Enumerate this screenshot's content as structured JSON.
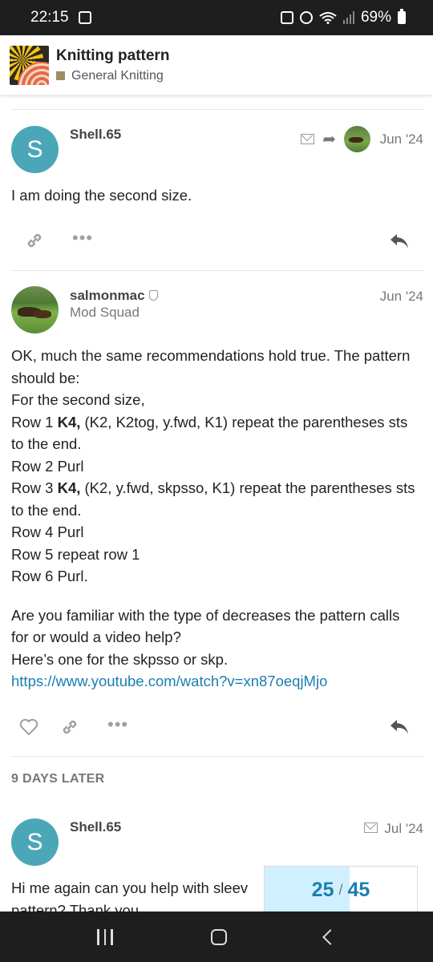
{
  "status_bar": {
    "time": "22:15",
    "battery": "69%"
  },
  "header": {
    "title": "Knitting pattern",
    "category": "General Knitting",
    "category_color": "#a18c61"
  },
  "posts": [
    {
      "username": "Shell.65",
      "avatar_letter": "S",
      "date": "Jun '24",
      "body": [
        "I am doing the second size."
      ]
    },
    {
      "username": "salmonmac",
      "user_title": "Mod Squad",
      "date": "Jun '24",
      "body": [
        "OK, much the same recommendations hold true. The pattern should be:",
        "For the second size,",
        "Row 1 ",
        "K4,",
        " (K2, K2tog, y.fwd, K1) repeat the parentheses sts to the end.",
        "Row 2 Purl",
        "Row 3 ",
        "K4,",
        " (K2, y.fwd, skpsso, K1) repeat the parentheses sts to the end.",
        "Row 4 Purl",
        "Row 5 repeat row 1",
        "Row 6 Purl.",
        "Are you familiar with the type of decreases the pattern calls for or would a video help?",
        "Here’s one for the skpsso or skp.",
        "https://www.youtube.com/watch?v=xn87oeqjMjo"
      ]
    },
    {
      "username": "Shell.65",
      "avatar_letter": "S",
      "date": "Jul '24",
      "body": [
        "Hi me again can you help with sleev",
        "pattern? Thank you"
      ]
    }
  ],
  "time_gap": "9 DAYS LATER",
  "progress": {
    "current": "25",
    "separator": "/",
    "total": "45",
    "fraction": 0.556
  },
  "colors": {
    "accent": "#1a7fb0",
    "avatar_bg": "#4ba7b8",
    "progress_fill": "#d1f0ff"
  }
}
